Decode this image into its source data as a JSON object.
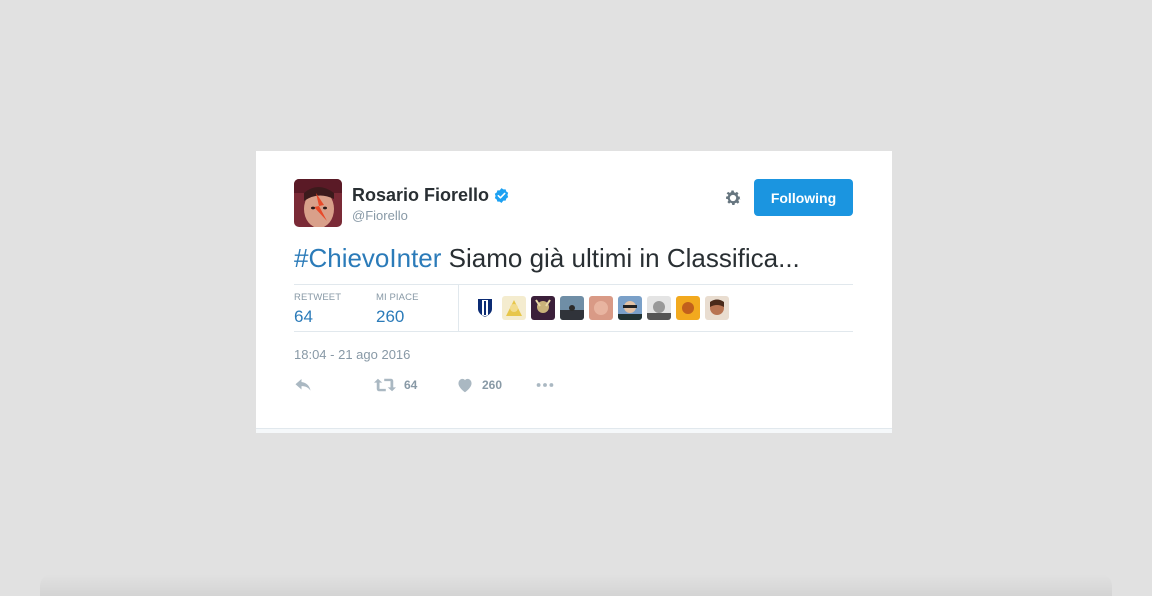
{
  "user": {
    "display_name": "Rosario Fiorello",
    "handle": "@Fiorello",
    "verified_icon": "verified-badge-icon",
    "avatar": "avatar"
  },
  "follow_button": {
    "label": "Following"
  },
  "tweet": {
    "hashtag": "#ChievoInter",
    "text": " Siamo già ultimi in Classifica..."
  },
  "stats": {
    "retweets_label": "RETWEET",
    "retweets_value": "64",
    "likes_label": "MI PIACE",
    "likes_value": "260"
  },
  "timestamp": "18:04 - 21 ago 2016",
  "actions": {
    "reply_icon": "reply-icon",
    "retweet_icon": "retweet-icon",
    "retweet_count": "64",
    "like_icon": "heart-icon",
    "like_count": "260",
    "more_icon": "more-icon"
  },
  "colors": {
    "accent": "#1b95e0",
    "link": "#2b7bb9",
    "text": "#292f33",
    "muted": "#8899a6",
    "verified": "#1da1f2"
  }
}
